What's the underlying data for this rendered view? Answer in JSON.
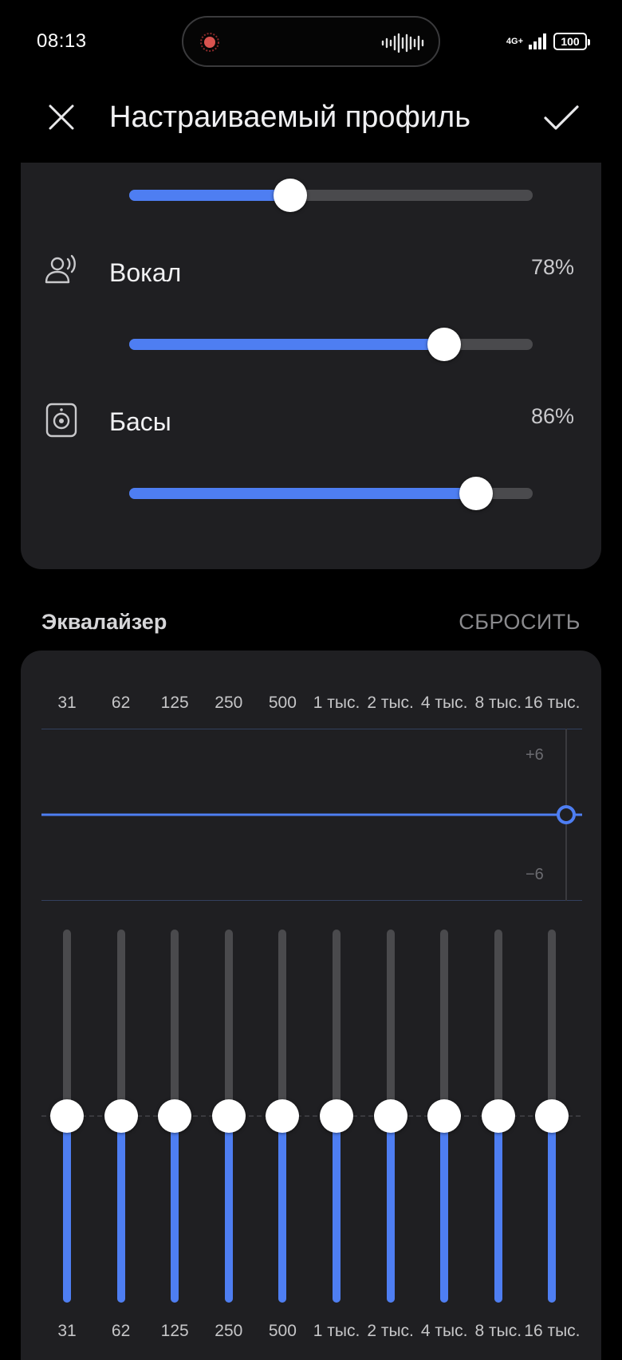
{
  "status_bar": {
    "time": "08:13",
    "network": "4G+",
    "battery": "100"
  },
  "header": {
    "title": "Настраиваемый профиль",
    "close_icon": "close-icon",
    "confirm_icon": "check-icon"
  },
  "settings": {
    "partial_slider_level": 0.4,
    "items": [
      {
        "icon": "voice-person-icon",
        "label": "Вокал",
        "value": "78%",
        "level": 0.78
      },
      {
        "icon": "speaker-icon",
        "label": "Басы",
        "value": "86%",
        "level": 0.86
      }
    ]
  },
  "equalizer": {
    "title": "Эквалайзер",
    "reset_label": "СБРОСИТЬ",
    "db_max": "+6",
    "db_min": "−6",
    "bands": [
      {
        "label": "31",
        "gain": 0
      },
      {
        "label": "62",
        "gain": 0
      },
      {
        "label": "125",
        "gain": 0
      },
      {
        "label": "250",
        "gain": 0
      },
      {
        "label": "500",
        "gain": 0
      },
      {
        "label": "1 тыс.",
        "gain": 0
      },
      {
        "label": "2 тыс.",
        "gain": 0
      },
      {
        "label": "4 тыс.",
        "gain": 0
      },
      {
        "label": "8 тыс.",
        "gain": 0
      },
      {
        "label": "16 тыс.",
        "gain": 0
      }
    ]
  },
  "colors": {
    "accent": "#4e7ef2",
    "card": "#1f1f22",
    "track": "#4a4a4d"
  }
}
